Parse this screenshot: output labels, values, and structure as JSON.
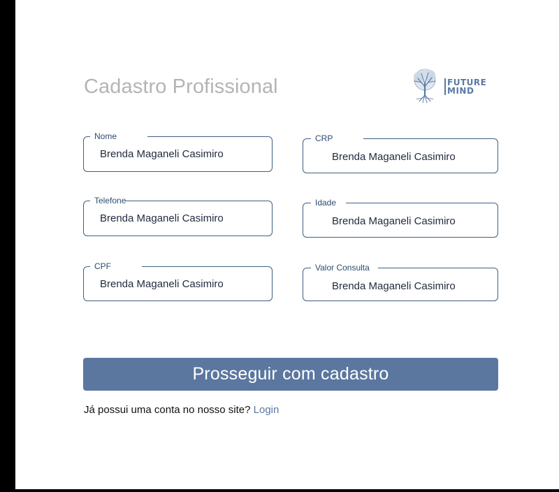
{
  "page": {
    "title": "Cadastro Profissional"
  },
  "logo": {
    "line1": "FUTURE",
    "line2": "MIND",
    "icon": "tree-icon",
    "color": "#5a7aa3"
  },
  "form": {
    "fields": {
      "nome": {
        "label": "Nome",
        "value": "Brenda Maganeli Casimiro"
      },
      "crp": {
        "label": "CRP",
        "value": "Brenda Maganeli Casimiro"
      },
      "telefone": {
        "label": "Telefone",
        "value": "Brenda Maganeli Casimiro"
      },
      "idade": {
        "label": "Idade",
        "value": "Brenda Maganeli Casimiro"
      },
      "cpf": {
        "label": "CPF",
        "value": "Brenda Maganeli Casimiro"
      },
      "valor_consulta": {
        "label": "Valor Consulta",
        "value": "Brenda Maganeli Casimiro"
      }
    },
    "submit_label": "Prosseguir com cadastro",
    "login_prompt": "Já possui uma conta no nosso site?",
    "login_link": "Login"
  },
  "colors": {
    "accent": "#5b77a0",
    "field_border": "#3e5f83",
    "title": "#b4b4b4"
  }
}
